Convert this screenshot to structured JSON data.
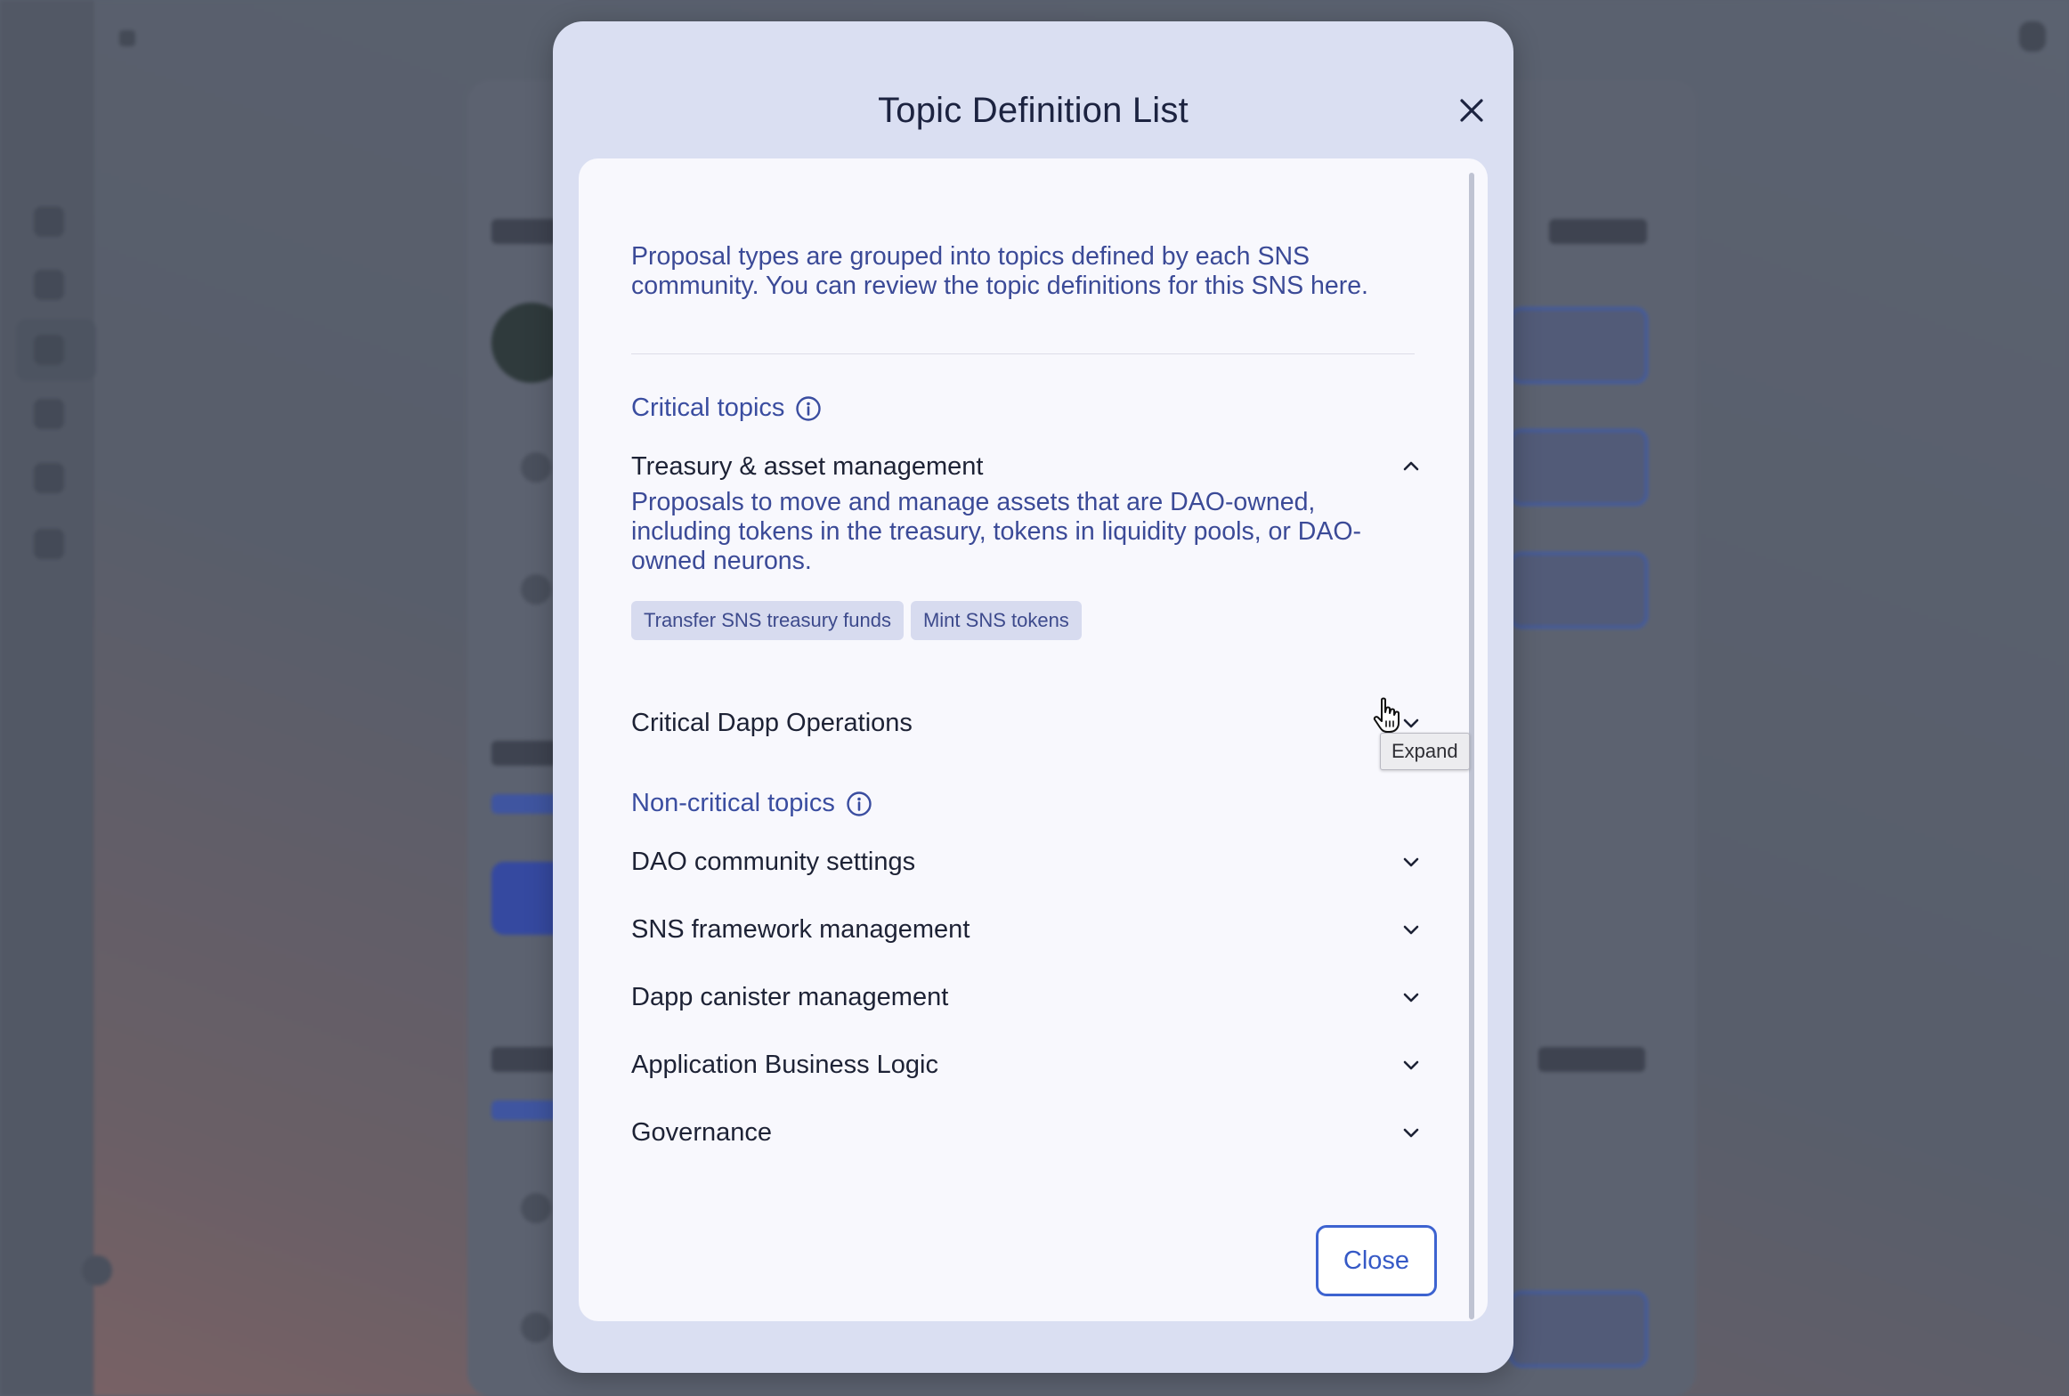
{
  "modal": {
    "title": "Topic Definition List",
    "intro": "Proposal types are grouped into topics defined by each SNS community. You can review the topic definitions for this SNS here.",
    "close_label": "Close"
  },
  "critical": {
    "heading": "Critical topics",
    "topics": [
      {
        "label": "Treasury & asset management",
        "expanded": true,
        "description": "Proposals to move and manage assets that are DAO-owned, including tokens in the treasury, tokens in liquidity pools, or DAO-owned neurons.",
        "tags": [
          "Transfer SNS treasury funds",
          "Mint SNS tokens"
        ]
      },
      {
        "label": "Critical Dapp Operations",
        "expanded": false
      }
    ]
  },
  "noncritical": {
    "heading": "Non-critical topics",
    "topics": [
      {
        "label": "DAO community settings"
      },
      {
        "label": "SNS framework management"
      },
      {
        "label": "Dapp canister management"
      },
      {
        "label": "Application Business Logic"
      },
      {
        "label": "Governance"
      }
    ]
  },
  "tooltip": {
    "text": "Expand"
  },
  "icons": {
    "close": "close-icon",
    "info": "info-icon",
    "chevron_up": "chevron-up-icon",
    "chevron_down": "chevron-down-icon",
    "cursor": "hand-pointer-cursor"
  },
  "colors": {
    "accent": "#3559c6",
    "topic_blue": "#3a4da0",
    "modal_bg": "#dadff2",
    "body_bg": "#f8f8fd"
  }
}
